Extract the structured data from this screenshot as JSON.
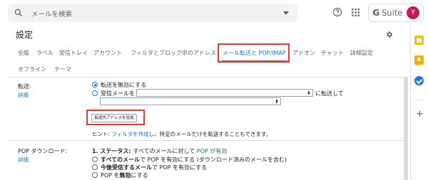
{
  "header": {
    "search_placeholder": "メールを検索",
    "brand_g": "G",
    "brand_text": "Suite",
    "avatar_letter": "Y"
  },
  "settings": {
    "title": "設定",
    "tabs_row1": [
      "全般",
      "ラベル",
      "受信トレイ",
      "アカウント",
      "フィルタとブロック中のアドレス",
      "メール転送と POP/IMAP",
      "アドオン",
      "チャット",
      "詳細設定"
    ],
    "tabs_row2": [
      "オフライン",
      "テーマ"
    ],
    "active_tab": "メール転送と POP/IMAP"
  },
  "forwarding": {
    "label": "転送:",
    "learn_more": "詳細",
    "option_disable": "転送を無効にする",
    "option_forward_prefix": "受信メールを",
    "option_forward_suffix": "に転送して",
    "blurred_text": "▪▪▪▪▪ ▪▪▪▪ ▪▪▪▪▪▪▪▪▪ ▪▪ ▪▪▪▪▪ ▪▪▪▪ ▪▪▪▪▪ ▪▪▪▪▪▪",
    "add_button": "転送先アドレスを追加",
    "hint_prefix": "ヒント: ",
    "hint_link": "フィルタを作成",
    "hint_suffix": "し、特定のメールだけを転送することもできます。"
  },
  "pop": {
    "label": "POP ダウンロード:",
    "learn_more": "詳細",
    "status_prefix": "1. ステータス: ",
    "status_text": "すべてのメールに対して ",
    "status_value": "POP が有効",
    "opt1_bold": "すべてのメール",
    "opt1_rest": "で POP を有効にする (ダウンロード済みのメールを含む)",
    "opt2_bold": "今後受信するメール",
    "opt2_rest": "で POP を有効にする",
    "opt3_prefix": "POP を",
    "opt3_bold": "無効",
    "opt3_suffix": "にする"
  },
  "colors": {
    "accent": "#1a73e8",
    "highlight": "#e53935",
    "status_green": "#188038",
    "avatar": "#c2185b"
  }
}
